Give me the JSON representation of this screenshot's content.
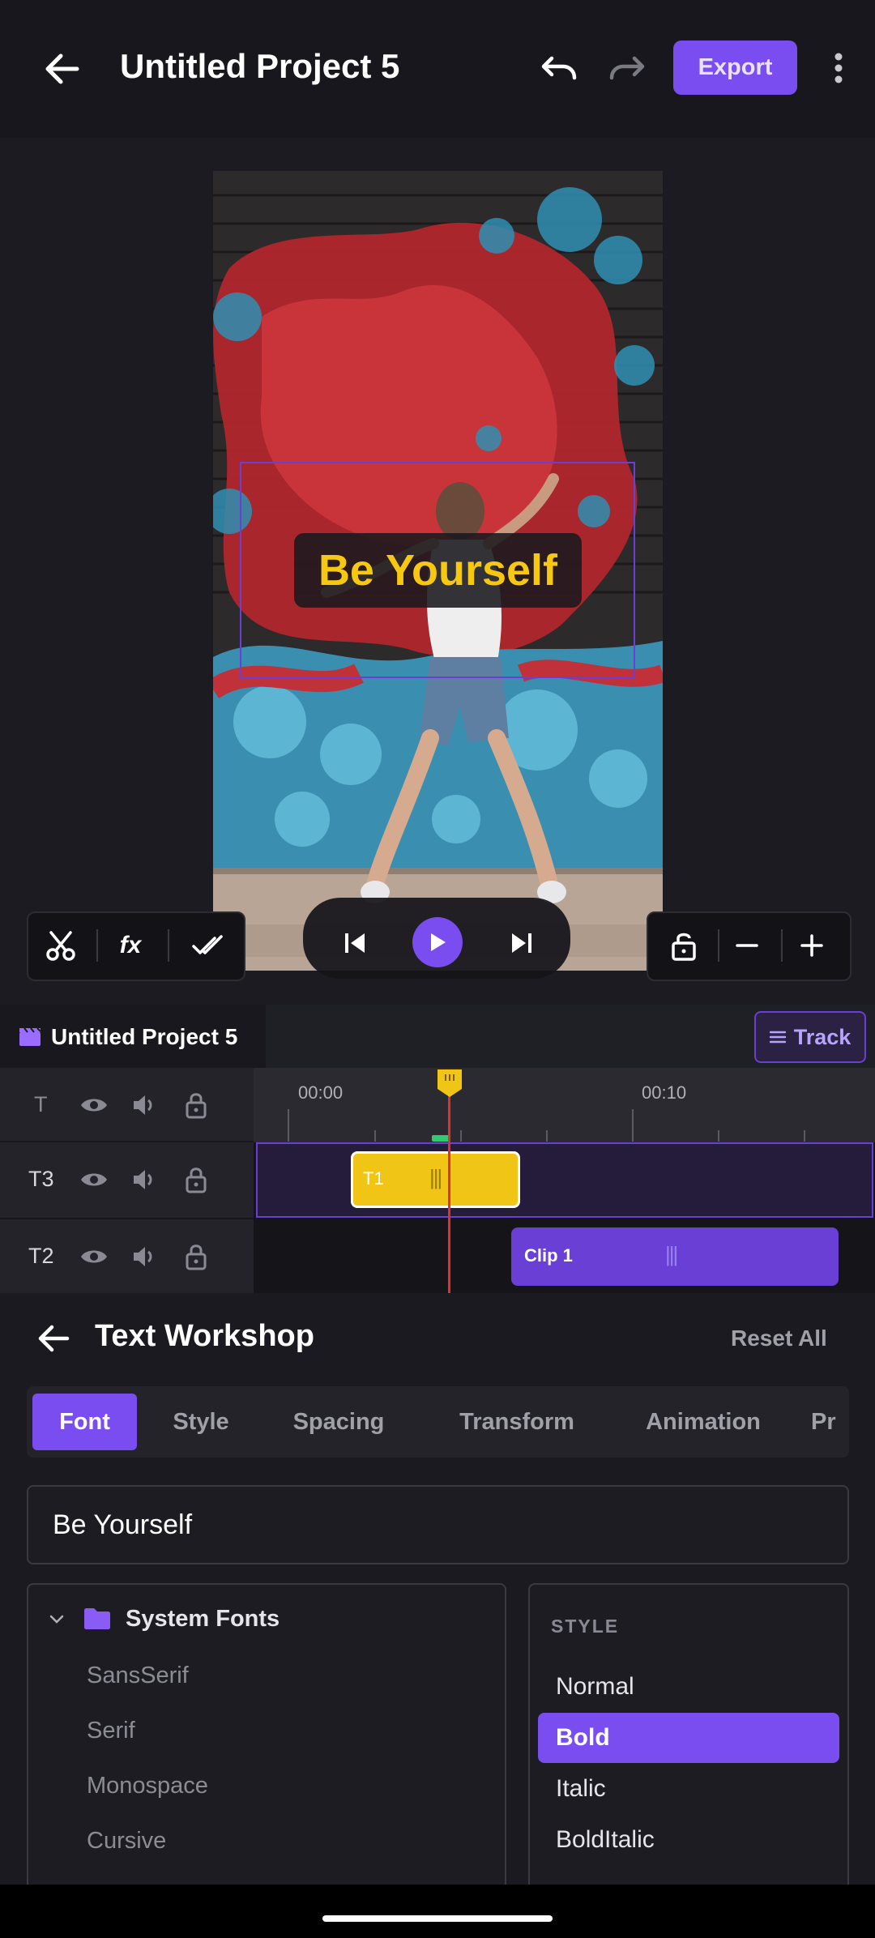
{
  "header": {
    "title": "Untitled Project 5",
    "export_label": "Export"
  },
  "preview": {
    "caption_text": "Be Yourself"
  },
  "timeline": {
    "project_label": "Untitled Project 5",
    "track_button": "Track",
    "ruler_ticks": [
      "00:00",
      "00:10"
    ],
    "rows": [
      {
        "label": "T"
      },
      {
        "label": "T3"
      },
      {
        "label": "T2"
      }
    ],
    "clip_t1_label": "T1",
    "clip_1_label": "Clip 1"
  },
  "workshop": {
    "title": "Text Workshop",
    "reset_all": "Reset All",
    "tabs": [
      "Font",
      "Style",
      "Spacing",
      "Transform",
      "Animation",
      "Pr"
    ],
    "active_tab": "Font",
    "text_value": "Be Yourself",
    "font_group": "System Fonts",
    "fonts": [
      "SansSerif",
      "Serif",
      "Monospace",
      "Cursive"
    ],
    "style_heading": "STYLE",
    "styles": [
      "Normal",
      "Bold",
      "Italic",
      "BoldItalic"
    ],
    "active_style": "Bold"
  },
  "colors": {
    "accent": "#7a4df0",
    "caption_text": "#f7c811",
    "playhead": "#e03131",
    "clip_text": "#f0c515"
  }
}
